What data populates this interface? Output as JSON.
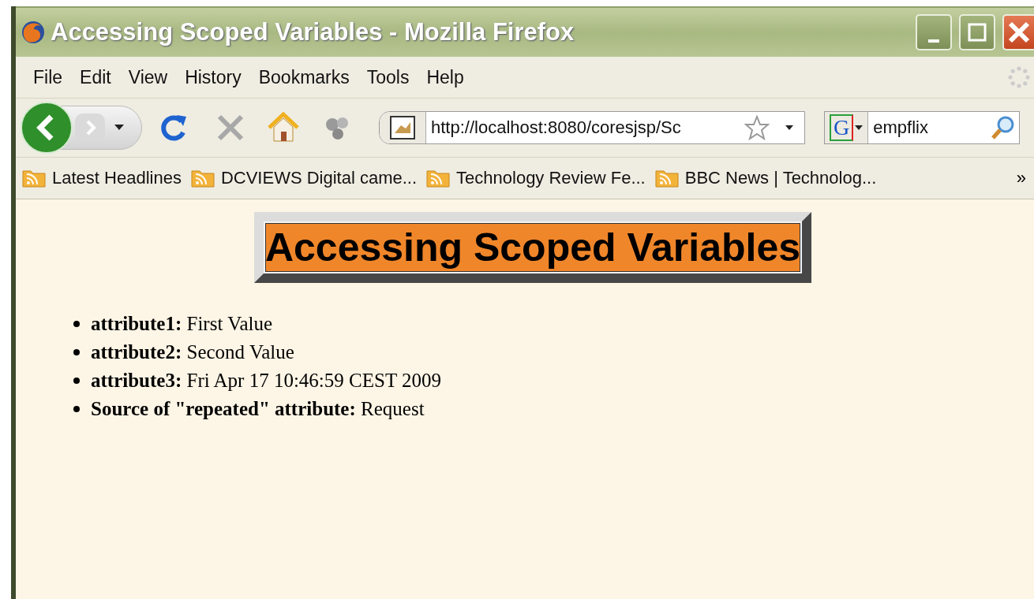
{
  "window": {
    "title": "Accessing Scoped Variables - Mozilla Firefox"
  },
  "menu": [
    "File",
    "Edit",
    "View",
    "History",
    "Bookmarks",
    "Tools",
    "Help"
  ],
  "toolbar": {
    "url": "http://localhost:8080/coresjsp/Sc",
    "search_engine": "G",
    "search_value": "empflix"
  },
  "bookmarks": [
    "Latest Headlines",
    "DCVIEWS Digital came...",
    "Technology Review Fe...",
    "BBC News | Technolog..."
  ],
  "bookmarks_overflow": "»",
  "page": {
    "heading": "Accessing Scoped Variables",
    "items": [
      "**attribute1:** First Value",
      "**attribute2:** Second Value",
      "**attribute3:** Fri Apr 17 10:46:59 CEST 2009",
      "**Source of \"repeated\" attribute:** Request"
    ]
  }
}
